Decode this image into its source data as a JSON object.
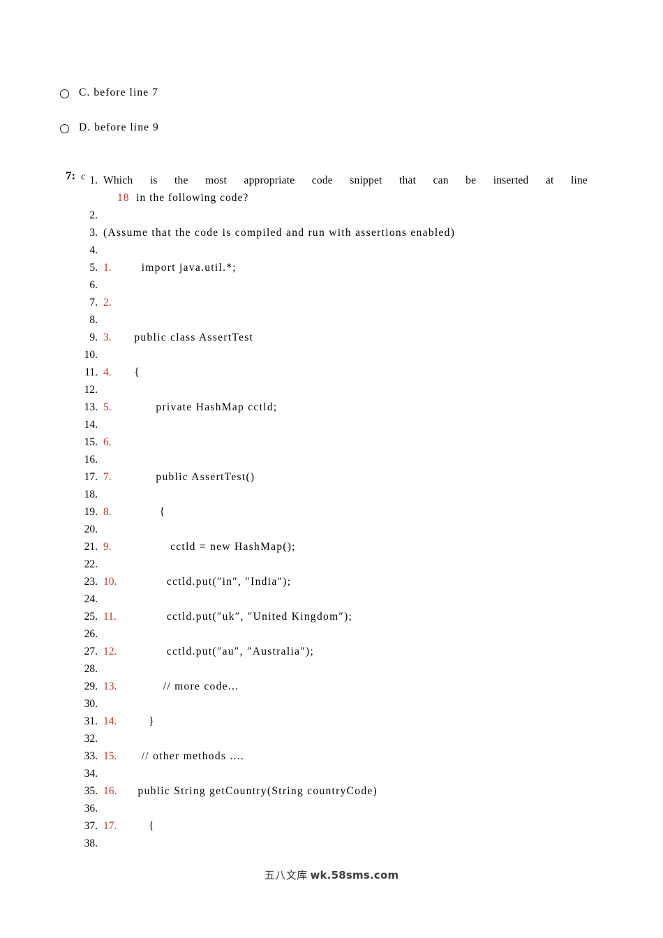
{
  "options": [
    {
      "icon": "radio-button-unchecked-icon",
      "label": "C. before line 7"
    },
    {
      "icon": "radio-button-unchecked-icon",
      "label": "D. before line 9"
    }
  ],
  "answer": {
    "number": "7:",
    "value": "c"
  },
  "colors": {
    "code_number_red": "#c0392b",
    "text_black": "#1a1a1a",
    "page_background": "#ffffff"
  },
  "question": {
    "line1": "Which is the most appropriate code snippet that can be inserted at line",
    "line2_highlight": "18",
    "line2_rest": "in the following code?",
    "assume_note": "(Assume that the code is compiled and run with assertions enabled)"
  },
  "listing": [
    {
      "n": "1.",
      "kind": "question-line1"
    },
    {
      "n": "2.",
      "kind": "blank"
    },
    {
      "n": "3.",
      "kind": "assume"
    },
    {
      "n": "4.",
      "kind": "blank"
    },
    {
      "n": "5.",
      "kind": "code",
      "code_num": "1.",
      "code": "    import java.util.*;"
    },
    {
      "n": "6.",
      "kind": "blank"
    },
    {
      "n": "7.",
      "kind": "code",
      "code_num": "2.",
      "code": ""
    },
    {
      "n": "8.",
      "kind": "blank"
    },
    {
      "n": "9.",
      "kind": "code",
      "code_num": "3.",
      "code": "  public class AssertTest"
    },
    {
      "n": "10.",
      "kind": "blank"
    },
    {
      "n": "11.",
      "kind": "code",
      "code_num": "4.",
      "code": "  {"
    },
    {
      "n": "12.",
      "kind": "blank"
    },
    {
      "n": "13.",
      "kind": "code",
      "code_num": "5.",
      "code": "        private HashMap cctld;"
    },
    {
      "n": "14.",
      "kind": "blank"
    },
    {
      "n": "15.",
      "kind": "code",
      "code_num": "6.",
      "code": ""
    },
    {
      "n": "16.",
      "kind": "blank"
    },
    {
      "n": "17.",
      "kind": "code",
      "code_num": "7.",
      "code": "        public AssertTest()"
    },
    {
      "n": "18.",
      "kind": "blank"
    },
    {
      "n": "19.",
      "kind": "code",
      "code_num": "8.",
      "code": "         {"
    },
    {
      "n": "20.",
      "kind": "blank"
    },
    {
      "n": "21.",
      "kind": "code",
      "code_num": "9.",
      "code": "            cctld = new HashMap();"
    },
    {
      "n": "22.",
      "kind": "blank"
    },
    {
      "n": "23.",
      "kind": "code",
      "code_num": "10.",
      "code": "           cctld.put(″in″, ″India″);"
    },
    {
      "n": "24.",
      "kind": "blank"
    },
    {
      "n": "25.",
      "kind": "code",
      "code_num": "11.",
      "code": "           cctld.put(″uk″, ″United Kingdom″);"
    },
    {
      "n": "26.",
      "kind": "blank"
    },
    {
      "n": "27.",
      "kind": "code",
      "code_num": "12.",
      "code": "           cctld.put(″au″, ″Australia″);"
    },
    {
      "n": "28.",
      "kind": "blank"
    },
    {
      "n": "29.",
      "kind": "code",
      "code_num": "13.",
      "code": "          // more code..."
    },
    {
      "n": "30.",
      "kind": "blank"
    },
    {
      "n": "31.",
      "kind": "code",
      "code_num": "14.",
      "code": "      }"
    },
    {
      "n": "32.",
      "kind": "blank"
    },
    {
      "n": "33.",
      "kind": "code",
      "code_num": "15.",
      "code": "    // other methods ...."
    },
    {
      "n": "34.",
      "kind": "blank"
    },
    {
      "n": "35.",
      "kind": "code",
      "code_num": "16.",
      "code": "   public String getCountry(String countryCode)"
    },
    {
      "n": "36.",
      "kind": "blank"
    },
    {
      "n": "37.",
      "kind": "code",
      "code_num": "17.",
      "code": "      {"
    },
    {
      "n": "38.",
      "kind": "blank"
    }
  ],
  "watermark": {
    "brand": "五八文库",
    "url": "wk.58sms.com"
  }
}
